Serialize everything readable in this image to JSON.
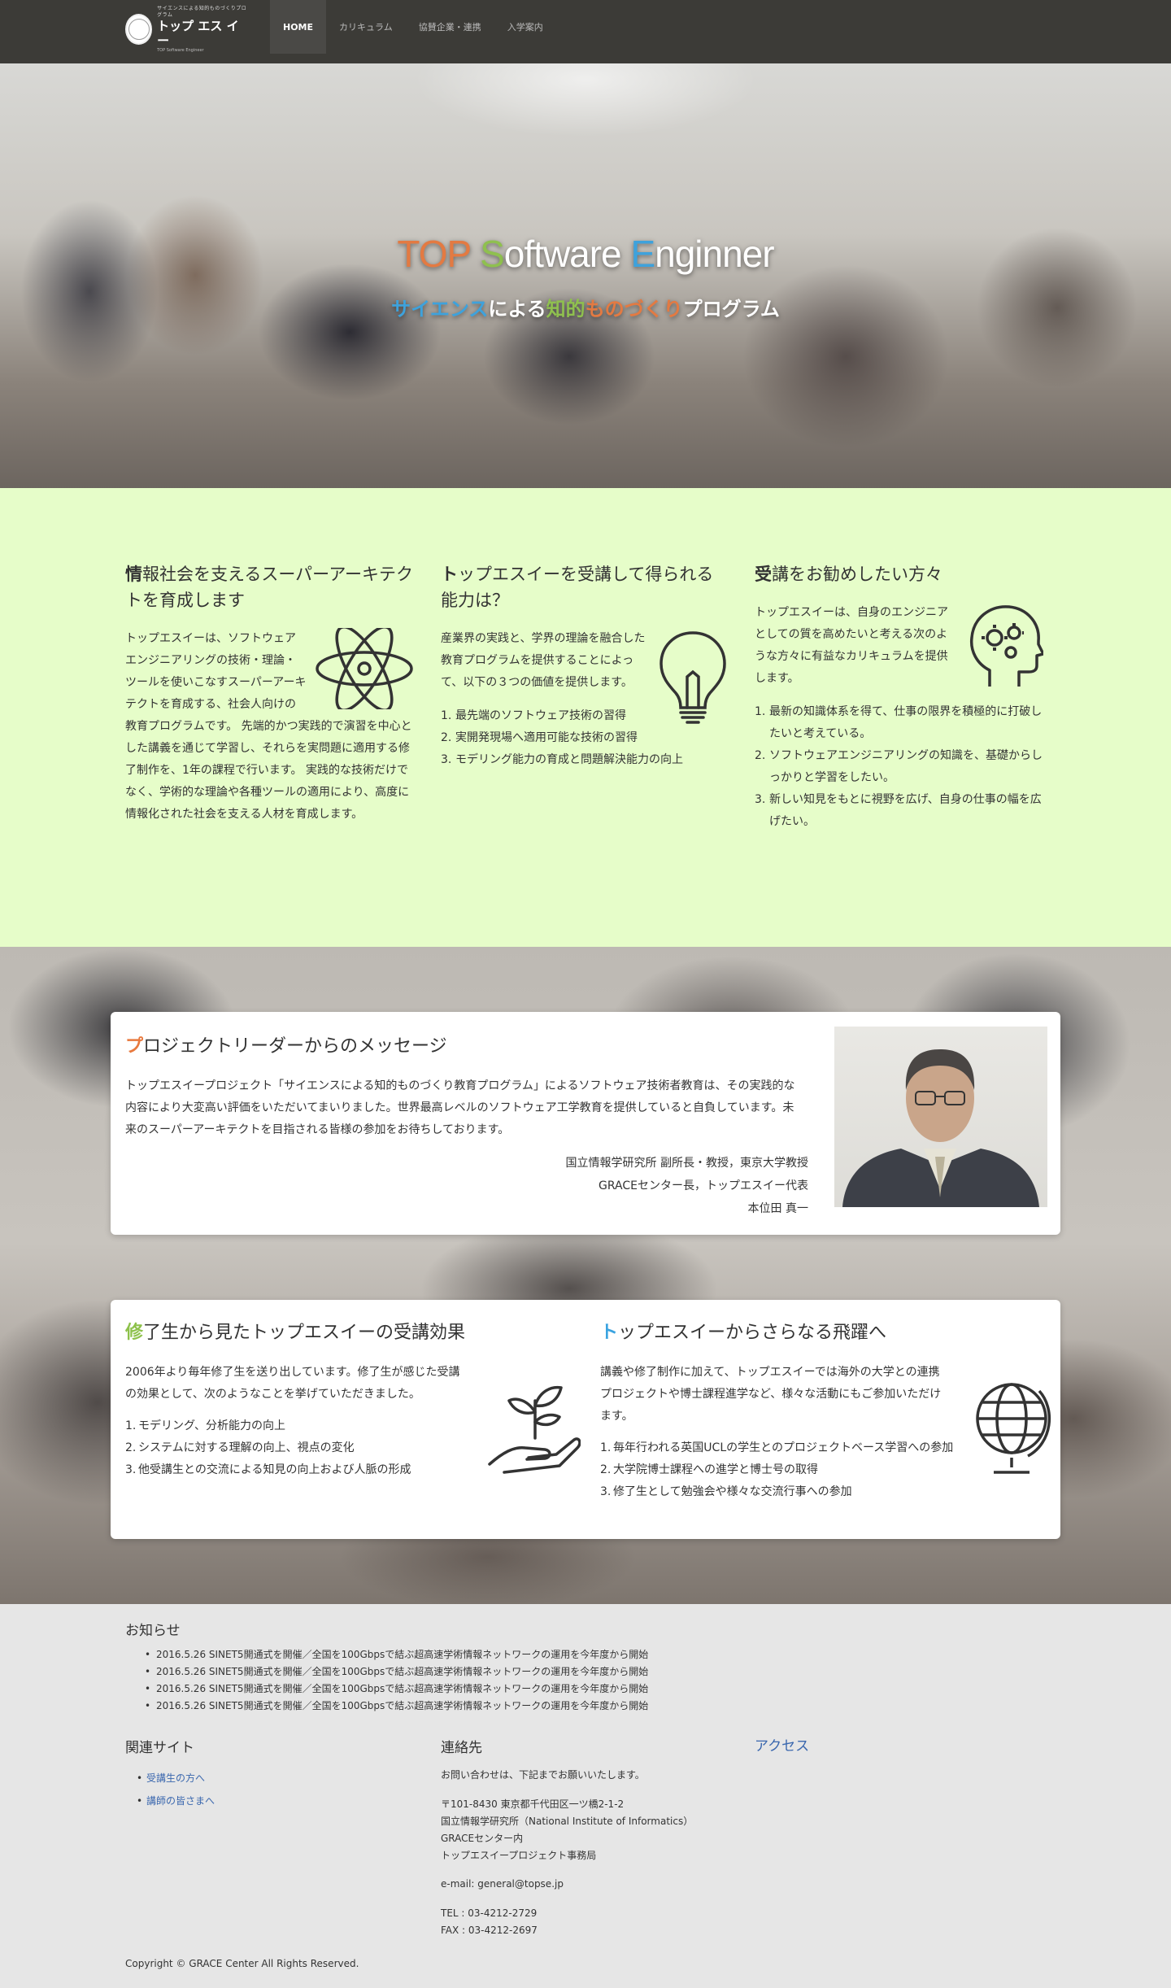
{
  "nav": {
    "logo": {
      "small": "サイエンスによる知的ものづくりプログラム",
      "big": "トップ エス イー",
      "tiny": "TOP Software Engineer"
    },
    "items": [
      {
        "label": "HOME",
        "active": true
      },
      {
        "label": "カリキュラム",
        "active": false
      },
      {
        "label": "協賛企業・連携",
        "active": false
      },
      {
        "label": "入学案内",
        "active": false
      }
    ]
  },
  "hero": {
    "title": {
      "t1": "TOP",
      "t2": " ",
      "t3": "S",
      "t4": "oftware ",
      "t5": "E",
      "t6": "nginner"
    },
    "subtitle": {
      "s1": "サイエンス",
      "s2": "による",
      "s3": "知的",
      "s4": "ものづくり",
      "s5": "プログラム"
    }
  },
  "columns": [
    {
      "title_first": "情",
      "title_rest": "報社会を支えるスーパーアーキテクトを育成します",
      "icon": "atom-icon",
      "body": "トップエスイーは、ソフトウェアエンジニアリングの技術・理論・ツールを使いこなすスーパーアーキテクトを育成する、社会人向けの教育プログラムです。 先端的かつ実践的で演習を中心とした講義を通じて学習し、それらを実問題に適用する修了制作を、1年の課程で行います。 実践的な技術だけでなく、学術的な理論や各種ツールの適用により、高度に情報化された社会を支える人材を育成します。"
    },
    {
      "title_first": "ト",
      "title_rest": "ップエスイーを受講して得られる能力は？",
      "icon": "lightbulb-icon",
      "body": "産業界の実践と、学界の理論を融合した教育プログラムを提供することによって、以下の３つの価値を提供します。",
      "list": [
        "最先端のソフトウェア技術の習得",
        "実開発現場へ適用可能な技術の習得",
        "モデリング能力の育成と問題解決能力の向上"
      ]
    },
    {
      "title_first": "受",
      "title_rest": "講をお勧めしたい方々",
      "icon": "head-gears-icon",
      "body": "トップエスイーは、自身のエンジニアとしての質を高めたいと考える次のような方々に有益なカリキュラムを提供します。",
      "list": [
        "最新の知識体系を得て、仕事の限界を積極的に打破したいと考えている。",
        "ソフトウェアエンジニアリングの知識を、基礎からしっかりと学習をしたい。",
        "新しい知見をもとに視野を広げ、自身の仕事の幅を広げたい。"
      ]
    }
  ],
  "message": {
    "title_first": "プ",
    "title_rest": "ロジェクトリーダーからのメッセージ",
    "body": "トップエスイープロジェクト「サイエンスによる知的ものづくり教育プログラム」によるソフトウェア技術者教育は、その実践的な内容により大変高い評価をいただいてまいりました。世界最高レベルのソフトウェア工学教育を提供していると自負しています。未来のスーパーアーキテクトを目指される皆様の参加をお待ちしております。",
    "sign": [
      "国立情報学研究所 副所長・教授，東京大学教授",
      "GRACEセンター長，トップエスイー代表",
      "本位田 真一"
    ]
  },
  "results": [
    {
      "title_first": "修",
      "title_rest": "了生から見たトップエスイーの受講効果",
      "icon": "plant-hand-icon",
      "body": "2006年より毎年修了生を送り出しています。修了生が感じた受講の効果として、次のようなことを挙げていただきました。",
      "list": [
        "モデリング、分析能力の向上",
        "システムに対する理解の向上、視点の変化",
        "他受講生との交流による知見の向上および人脈の形成"
      ]
    },
    {
      "title_first": "ト",
      "title_rest": "ップエスイーからさらなる飛躍へ",
      "icon": "globe-icon",
      "body": "講義や修了制作に加えて、トップエスイーでは海外の大学との連携プロジェクトや博士課程進学など、様々な活動にもご参加いただけます。",
      "list": [
        "毎年行われる英国UCLの学生とのプロジェクトベース学習への参加",
        "大学院博士課程への進学と博士号の取得",
        "修了生として勉強会や様々な交流行事への参加"
      ]
    }
  ],
  "footer": {
    "news_title": "お知らせ",
    "news": [
      "2016.5.26 SINET5開通式を開催／全国を100Gbpsで結ぶ超高速学術情報ネットワークの運用を今年度から開始",
      "2016.5.26 SINET5開通式を開催／全国を100Gbpsで結ぶ超高速学術情報ネットワークの運用を今年度から開始",
      "2016.5.26 SINET5開通式を開催／全国を100Gbpsで結ぶ超高速学術情報ネットワークの運用を今年度から開始",
      "2016.5.26 SINET5開通式を開催／全国を100Gbpsで結ぶ超高速学術情報ネットワークの運用を今年度から開始"
    ],
    "related_title": "関連サイト",
    "related": [
      "受講生の方へ",
      "講師の皆さまへ"
    ],
    "contact_title": "連絡先",
    "contact_intro": "お問い合わせは、下記までお願いいたします。",
    "address": [
      "〒101-8430 東京都千代田区一ツ橋2-1-2",
      "国立情報学研究所（National Institute of Informatics）",
      "GRACEセンター内",
      "トップエスイープロジェクト事務局"
    ],
    "email": "e-mail: general@topse.jp",
    "tel": "TEL : 03-4212-2729",
    "fax": "FAX : 03-4212-2697",
    "access": "アクセス",
    "copyright": "Copyright © GRACE Center All Rights Reserved."
  },
  "colors": {
    "orange": "#e8793e",
    "green": "#8dc14a",
    "blue": "#3aa3e0",
    "nav_bg": "#3c3b37",
    "section_green": "#e6fdc9"
  }
}
